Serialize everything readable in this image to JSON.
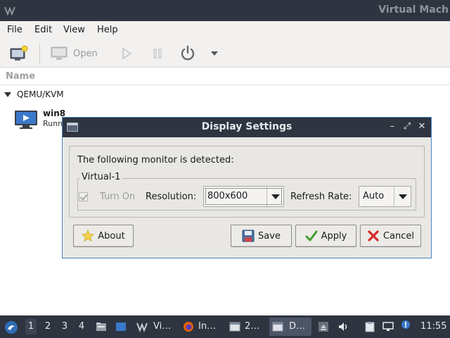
{
  "vmm": {
    "window_title": "Virtual Mach",
    "menu": [
      "File",
      "Edit",
      "View",
      "Help"
    ],
    "toolbar": {
      "open_label": "Open"
    },
    "list_header": "Name",
    "group": "QEMU/KVM",
    "vm": {
      "name": "win8",
      "status": "Runn"
    }
  },
  "dialog": {
    "title": "Display Settings",
    "detected_text": "The following monitor is detected:",
    "monitor_name": "Virtual-1",
    "turn_on_label": "Turn On",
    "turn_on_checked": true,
    "resolution_label": "Resolution:",
    "resolution_value": "800x600",
    "refresh_label": "Refresh Rate:",
    "refresh_value": "Auto",
    "buttons": {
      "about": "About",
      "save": "Save",
      "apply": "Apply",
      "cancel": "Cancel"
    },
    "controls": {
      "minimize": "–",
      "maximize": "⤢",
      "close": "✕"
    }
  },
  "taskbar": {
    "workspaces": [
      "1",
      "2",
      "3",
      "4"
    ],
    "active_workspace": "1",
    "tasks": [
      {
        "label": "Vi…",
        "icon": "virt-manager-icon"
      },
      {
        "label": "In…",
        "icon": "firefox-icon"
      },
      {
        "label": "2…",
        "icon": "window-icon"
      },
      {
        "label": "D…",
        "icon": "window-icon"
      }
    ],
    "clock": "11:55"
  },
  "colors": {
    "titlebar": "#2e3440",
    "dialog_bg": "#e8e7e4",
    "dialog_border": "#4b86c6",
    "accent_blue": "#3a78c9"
  }
}
